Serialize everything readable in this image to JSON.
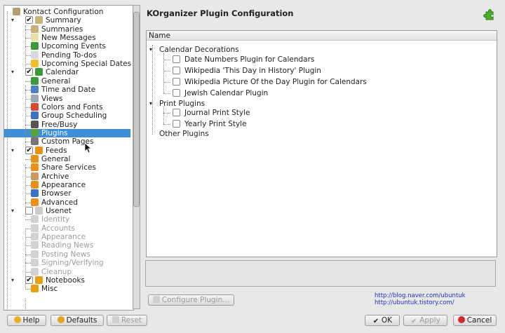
{
  "window": {
    "title": "KOrganizer Plugin Configuration"
  },
  "tree": {
    "items": [
      {
        "label": "Kontact Configuration",
        "level": 0,
        "icon": "kontact-icon",
        "color": "#b0a070",
        "check": null,
        "disabled": false
      },
      {
        "label": "Summary",
        "level": 1,
        "icon": "summary-icon",
        "color": "#c8b27a",
        "check": true,
        "disabled": false
      },
      {
        "label": "Summaries",
        "level": 2,
        "icon": "summaries-icon",
        "color": "#c8b27a",
        "check": null,
        "disabled": false
      },
      {
        "label": "New Messages",
        "level": 2,
        "icon": "mail-icon",
        "color": "#e8e0a8",
        "check": null,
        "disabled": false
      },
      {
        "label": "Upcoming Events",
        "level": 2,
        "icon": "calendar-icon",
        "color": "#3a9a3a",
        "check": null,
        "disabled": false
      },
      {
        "label": "Pending To-dos",
        "level": 2,
        "icon": "todo-icon",
        "color": "#d9d9d9",
        "check": null,
        "disabled": false
      },
      {
        "label": "Upcoming Special Dates",
        "level": 2,
        "icon": "star-icon",
        "color": "#f0c030",
        "check": null,
        "disabled": false
      },
      {
        "label": "Calendar",
        "level": 1,
        "icon": "calendar-icon",
        "color": "#3a9a3a",
        "check": true,
        "disabled": false
      },
      {
        "label": "General",
        "level": 2,
        "icon": "calendar-icon",
        "color": "#3a9a3a",
        "check": null,
        "disabled": false
      },
      {
        "label": "Time and Date",
        "level": 2,
        "icon": "clock-icon",
        "color": "#4a7fc0",
        "check": null,
        "disabled": false
      },
      {
        "label": "Views",
        "level": 2,
        "icon": "views-icon",
        "color": "#9aa8b8",
        "check": null,
        "disabled": false
      },
      {
        "label": "Colors and Fonts",
        "level": 2,
        "icon": "colors-icon",
        "color": "#d84a30",
        "check": null,
        "disabled": false
      },
      {
        "label": "Group Scheduling",
        "level": 2,
        "icon": "globe-icon",
        "color": "#3a72c8",
        "check": null,
        "disabled": false
      },
      {
        "label": "Free/Busy",
        "level": 2,
        "icon": "free-busy-icon",
        "color": "#555555",
        "check": null,
        "disabled": false
      },
      {
        "label": "Plugins",
        "level": 2,
        "icon": "plugin-icon",
        "color": "#5aa03a",
        "check": null,
        "disabled": false,
        "selected": true
      },
      {
        "label": "Custom Pages",
        "level": 2,
        "icon": "wrench-icon",
        "color": "#777777",
        "check": null,
        "disabled": false
      },
      {
        "label": "Feeds",
        "level": 1,
        "icon": "feeds-icon",
        "color": "#e8901a",
        "check": true,
        "disabled": false
      },
      {
        "label": "General",
        "level": 2,
        "icon": "feeds-icon",
        "color": "#e8901a",
        "check": null,
        "disabled": false
      },
      {
        "label": "Share Services",
        "level": 2,
        "icon": "share-icon",
        "color": "#e8901a",
        "check": null,
        "disabled": false
      },
      {
        "label": "Archive",
        "level": 2,
        "icon": "archive-icon",
        "color": "#c89860",
        "check": null,
        "disabled": false
      },
      {
        "label": "Appearance",
        "level": 2,
        "icon": "appearance-icon",
        "color": "#e8901a",
        "check": null,
        "disabled": false
      },
      {
        "label": "Browser",
        "level": 2,
        "icon": "globe-icon",
        "color": "#3a72c8",
        "check": null,
        "disabled": false
      },
      {
        "label": "Advanced",
        "level": 2,
        "icon": "advanced-icon",
        "color": "#e8901a",
        "check": null,
        "disabled": false
      },
      {
        "label": "Usenet",
        "level": 1,
        "icon": "usenet-icon",
        "color": "#cccccc",
        "check": false,
        "disabled": false
      },
      {
        "label": "Identity",
        "level": 2,
        "icon": "identity-icon",
        "color": "#d2d2d2",
        "check": null,
        "disabled": true
      },
      {
        "label": "Accounts",
        "level": 2,
        "icon": "accounts-icon",
        "color": "#d2d2d2",
        "check": null,
        "disabled": true
      },
      {
        "label": "Appearance",
        "level": 2,
        "icon": "appearance-icon",
        "color": "#d2d2d2",
        "check": null,
        "disabled": true
      },
      {
        "label": "Reading News",
        "level": 2,
        "icon": "reading-icon",
        "color": "#d2d2d2",
        "check": null,
        "disabled": true
      },
      {
        "label": "Posting News",
        "level": 2,
        "icon": "posting-icon",
        "color": "#d2d2d2",
        "check": null,
        "disabled": true
      },
      {
        "label": "Signing/Verifying",
        "level": 2,
        "icon": "signing-icon",
        "color": "#d2d2d2",
        "check": null,
        "disabled": true
      },
      {
        "label": "Cleanup",
        "level": 2,
        "icon": "cleanup-icon",
        "color": "#d2d2d2",
        "check": null,
        "disabled": true
      },
      {
        "label": "Notebooks",
        "level": 1,
        "icon": "notebooks-icon",
        "color": "#e8a010",
        "check": true,
        "disabled": false
      },
      {
        "label": "Misc",
        "level": 2,
        "icon": "notebooks-icon",
        "color": "#e8a010",
        "check": null,
        "disabled": false
      }
    ]
  },
  "plugins": {
    "column_header": "Name",
    "rows": [
      {
        "label": "Calendar Decorations",
        "level": 0,
        "check": null
      },
      {
        "label": "Date Numbers Plugin for Calendars",
        "level": 1,
        "check": false
      },
      {
        "label": "Wikipedia 'This Day in History' Plugin",
        "level": 1,
        "check": false
      },
      {
        "label": "Wikipedia Picture Of the Day Plugin for Calendars",
        "level": 1,
        "check": false
      },
      {
        "label": "Jewish Calendar Plugin",
        "level": 1,
        "check": false
      },
      {
        "label": "Print Plugins",
        "level": 0,
        "check": null
      },
      {
        "label": "Journal Print Style",
        "level": 1,
        "check": false
      },
      {
        "label": "Yearly Print Style",
        "level": 1,
        "check": false
      },
      {
        "label": "Other Plugins",
        "level": 0,
        "check": null
      }
    ]
  },
  "buttons": {
    "configure_plugin": "Configure Plugin...",
    "help": "Help",
    "defaults": "Defaults",
    "reset": "Reset",
    "ok": "OK",
    "apply": "Apply",
    "cancel": "Cancel"
  },
  "watermark": {
    "line1": "http://blog.naver.com/ubuntuk",
    "line2": "http://ubuntuk.tistory.com/"
  },
  "colors": {
    "selection": "#3d8fd6",
    "link": "#1c2fc0",
    "plugin_icon": "#4caf2a"
  }
}
